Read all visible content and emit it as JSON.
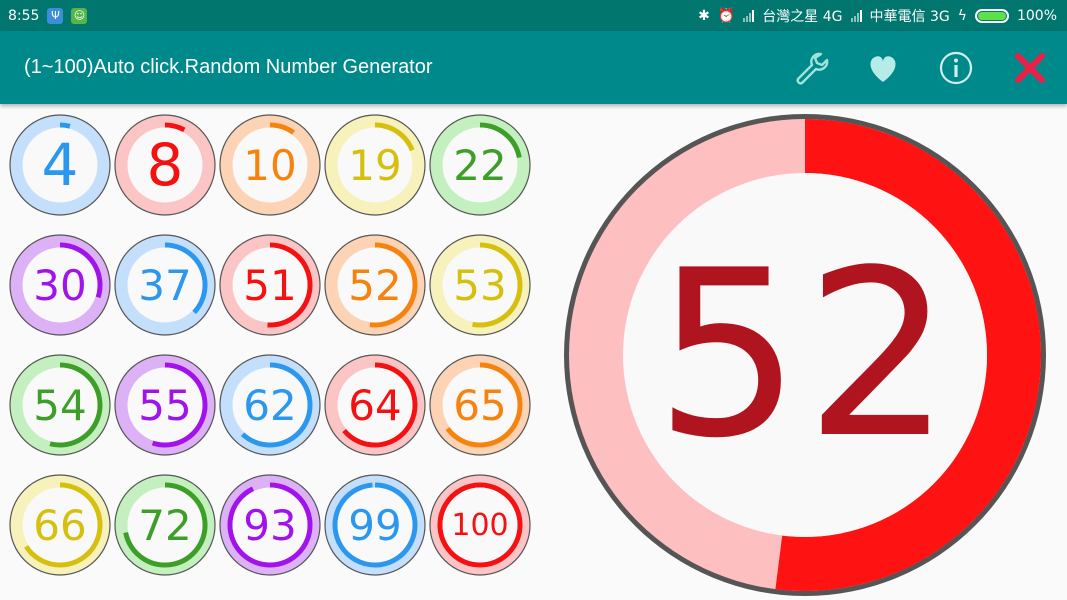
{
  "status_bar": {
    "time": "8:55",
    "carrier1": "台灣之星 4G",
    "carrier2": "中華電信 3G",
    "battery": "100%",
    "icons": [
      "usb-icon",
      "android-icon",
      "bluetooth-icon",
      "alarm-icon",
      "signal-icon",
      "charging-icon",
      "battery-icon"
    ]
  },
  "app_bar": {
    "title": "(1~100)Auto click.Random Number Generator",
    "actions": [
      "wrench-icon",
      "heart-icon",
      "info-icon",
      "close-icon"
    ]
  },
  "palette": {
    "blue": {
      "fill": "#c3dffb",
      "stroke": "#2c97ee",
      "text": "#2c97ee"
    },
    "red": {
      "fill": "#fcc5c5",
      "stroke": "#f51111",
      "text": "#f51111"
    },
    "orange": {
      "fill": "#fcd3b4",
      "stroke": "#f6830e",
      "text": "#f6830e"
    },
    "yellow": {
      "fill": "#f7f1bb",
      "stroke": "#d4c00d",
      "text": "#d4c00d"
    },
    "green": {
      "fill": "#c3f0be",
      "stroke": "#3e9f28",
      "text": "#3e9f28"
    },
    "purple": {
      "fill": "#dcb1f6",
      "stroke": "#a213ec",
      "text": "#a213ec"
    }
  },
  "drawn_numbers": [
    {
      "value": "4",
      "color": "blue",
      "progress": 0.04
    },
    {
      "value": "8",
      "color": "red",
      "progress": 0.08
    },
    {
      "value": "10",
      "color": "orange",
      "progress": 0.1
    },
    {
      "value": "19",
      "color": "yellow",
      "progress": 0.19
    },
    {
      "value": "22",
      "color": "green",
      "progress": 0.22
    },
    {
      "value": "30",
      "color": "purple",
      "progress": 0.3
    },
    {
      "value": "37",
      "color": "blue",
      "progress": 0.37
    },
    {
      "value": "51",
      "color": "red",
      "progress": 0.51
    },
    {
      "value": "52",
      "color": "orange",
      "progress": 0.52
    },
    {
      "value": "53",
      "color": "yellow",
      "progress": 0.53
    },
    {
      "value": "54",
      "color": "green",
      "progress": 0.54
    },
    {
      "value": "55",
      "color": "purple",
      "progress": 0.55
    },
    {
      "value": "62",
      "color": "blue",
      "progress": 0.62
    },
    {
      "value": "64",
      "color": "red",
      "progress": 0.64
    },
    {
      "value": "65",
      "color": "orange",
      "progress": 0.65
    },
    {
      "value": "66",
      "color": "yellow",
      "progress": 0.66
    },
    {
      "value": "72",
      "color": "green",
      "progress": 0.72
    },
    {
      "value": "93",
      "color": "purple",
      "progress": 0.93
    },
    {
      "value": "99",
      "color": "blue",
      "progress": 0.99
    },
    {
      "value": "100",
      "color": "red",
      "progress": 1.0
    }
  ],
  "current": {
    "value": "52",
    "progress": 0.52,
    "colors": {
      "track": "#fdbfbf",
      "arc": "#ff1212",
      "center": "#f9f9f9",
      "outline": "#555555",
      "text": "#b0141f"
    }
  }
}
